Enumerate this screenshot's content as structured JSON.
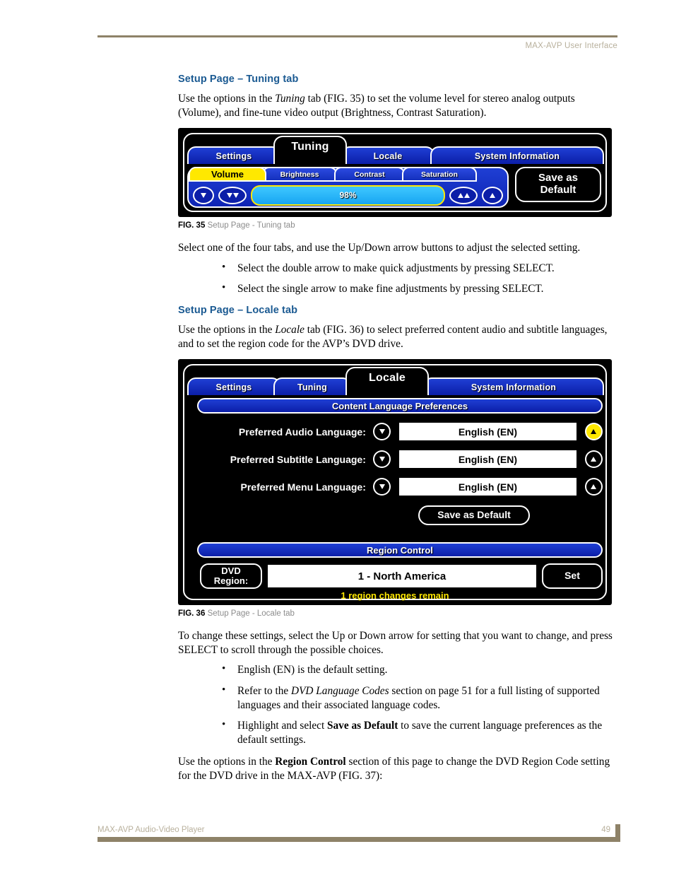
{
  "header": {
    "title": "MAX-AVP User Interface"
  },
  "footer": {
    "doc_title": "MAX-AVP Audio-Video Player",
    "page_number": "49"
  },
  "colors": {
    "heading_blue": "#1b5a92",
    "rule_tan": "#8e8268",
    "osd_blue": "#0b1ea8",
    "osd_highlight_yellow": "#ffe800",
    "slider_cyan": "#3fc8ff"
  },
  "sections": [
    {
      "heading": "Setup Page – Tuning tab",
      "intro_parts": {
        "a": "Use the options in the ",
        "italic": "Tuning",
        "b": " tab (FIG. 35) to set the volume level for stereo analog outputs (Volume), and fine-tune video output (Brightness, Contrast Saturation)."
      }
    }
  ],
  "fig35": {
    "caption_num": "FIG. 35",
    "caption_text": "Setup Page - Tuning tab",
    "tabs": [
      {
        "label": "Settings",
        "active": false
      },
      {
        "label": "Tuning",
        "active": true
      },
      {
        "label": "Locale",
        "active": false
      },
      {
        "label": "System Information",
        "active": false
      }
    ],
    "param_tabs": [
      {
        "label": "Volume",
        "selected": true
      },
      {
        "label": "Brightness",
        "selected": false
      },
      {
        "label": "Contrast",
        "selected": false
      },
      {
        "label": "Saturation",
        "selected": false
      }
    ],
    "slider_value": "98%",
    "save_default_label": "Save as\nDefault",
    "save_default_line1": "Save as",
    "save_default_line2": "Default"
  },
  "after_fig35": {
    "paragraph": "Select one of the four tabs, and use the Up/Down arrow buttons to adjust the selected setting.",
    "bullets": [
      "Select the double arrow to make quick adjustments by pressing SELECT.",
      "Select the single arrow to make fine adjustments by pressing SELECT."
    ]
  },
  "locale_section": {
    "heading": "Setup Page – Locale tab",
    "intro_a": "Use the options in the ",
    "intro_italic": "Locale",
    "intro_b": " tab (FIG. 36) to select preferred content audio and subtitle languages, and to set the region code for the AVP’s DVD drive."
  },
  "fig36": {
    "caption_num": "FIG. 36",
    "caption_text": "Setup Page - Locale tab",
    "tabs": [
      {
        "label": "Settings",
        "active": false
      },
      {
        "label": "Tuning",
        "active": false
      },
      {
        "label": "Locale",
        "active": true
      },
      {
        "label": "System Information",
        "active": false
      }
    ],
    "content_lang_bar": "Content Language Preferences",
    "language_rows": [
      {
        "label": "Preferred Audio Language:",
        "value": "English (EN)",
        "up_highlighted": true
      },
      {
        "label": "Preferred Subtitle Language:",
        "value": "English (EN)",
        "up_highlighted": false
      },
      {
        "label": "Preferred Menu Language:",
        "value": "English (EN)",
        "up_highlighted": false
      }
    ],
    "save_default_label": "Save as Default",
    "region_bar": "Region Control",
    "dvd_region_line1": "DVD",
    "dvd_region_line2": "Region:",
    "region_value": "1 - North America",
    "set_label": "Set",
    "region_note": "1 region changes remain"
  },
  "after_fig36": {
    "paragraph": "To change these settings, select the Up or Down arrow for setting that you want to change, and press SELECT to scroll through the possible choices.",
    "bullets": [
      {
        "parts": [
          {
            "t": "English (EN) is the default setting.",
            "style": "normal"
          }
        ]
      },
      {
        "parts": [
          {
            "t": "Refer to the ",
            "style": "normal"
          },
          {
            "t": "DVD Language Codes",
            "style": "italic"
          },
          {
            "t": " section on page 51 for a full listing of supported languages and their associated language codes.",
            "style": "normal"
          }
        ]
      },
      {
        "parts": [
          {
            "t": "Highlight and select ",
            "style": "normal"
          },
          {
            "t": "Save as Default",
            "style": "bold"
          },
          {
            "t": " to save the current language preferences as the default settings.",
            "style": "normal"
          }
        ]
      }
    ],
    "closing_a": "Use the options in the ",
    "closing_bold": "Region Control",
    "closing_b": " section of this page to change the DVD Region Code setting for the DVD drive in the MAX-AVP (FIG. 37):"
  }
}
